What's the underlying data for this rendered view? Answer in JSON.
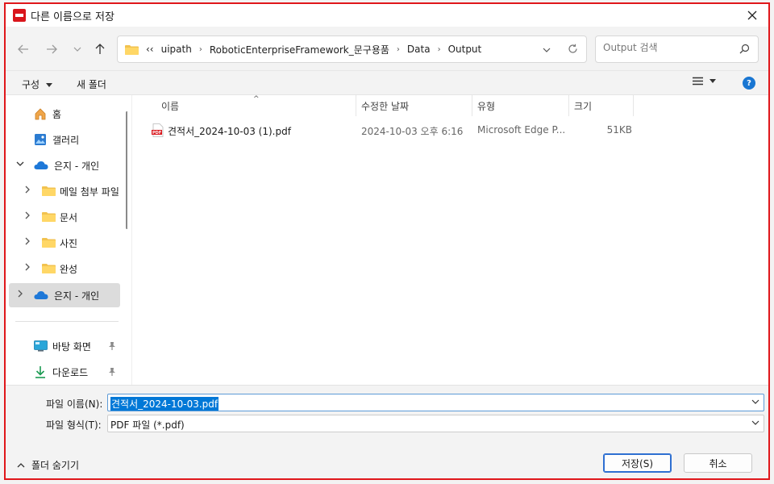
{
  "window": {
    "title": "다른 이름으로 저장"
  },
  "address": {
    "crumbs": [
      "uipath",
      "RoboticEnterpriseFramework_문구용품",
      "Data",
      "Output"
    ],
    "overflow": "‹‹"
  },
  "search": {
    "placeholder": "Output 검색"
  },
  "toolbar": {
    "organize": "구성",
    "new_folder": "새 폴더"
  },
  "sidebar": {
    "items": [
      {
        "label": "홈",
        "icon": "home-icon"
      },
      {
        "label": "갤러리",
        "icon": "gallery-icon"
      },
      {
        "label": "은지 - 개인",
        "icon": "onedrive-icon"
      },
      {
        "label": "메일 첨부 파일",
        "icon": "folder-icon"
      },
      {
        "label": "문서",
        "icon": "folder-icon"
      },
      {
        "label": "사진",
        "icon": "folder-icon"
      },
      {
        "label": "완성",
        "icon": "folder-icon"
      },
      {
        "label": "은지 - 개인",
        "icon": "onedrive-icon"
      },
      {
        "label": "바탕 화면",
        "icon": "desktop-icon"
      },
      {
        "label": "다운로드",
        "icon": "download-icon"
      }
    ]
  },
  "columns": {
    "name": "이름",
    "date": "수정한 날짜",
    "type": "유형",
    "size": "크기"
  },
  "files": [
    {
      "name": "견적서_2024-10-03 (1).pdf",
      "date": "2024-10-03 오후 6:16",
      "type": "Microsoft Edge P...",
      "size": "51KB"
    }
  ],
  "form": {
    "filename_label": "파일 이름(N):",
    "filename_value": "견적서_2024-10-03.pdf",
    "filetype_label": "파일 형식(T):",
    "filetype_value": "PDF 파일 (*.pdf)"
  },
  "footer": {
    "hide_folders": "폴더 숨기기",
    "save": "저장(S)",
    "cancel": "취소"
  },
  "colors": {
    "accent": "#0078d7",
    "frame": "#e0171b",
    "pdf_red": "#d9161c"
  }
}
